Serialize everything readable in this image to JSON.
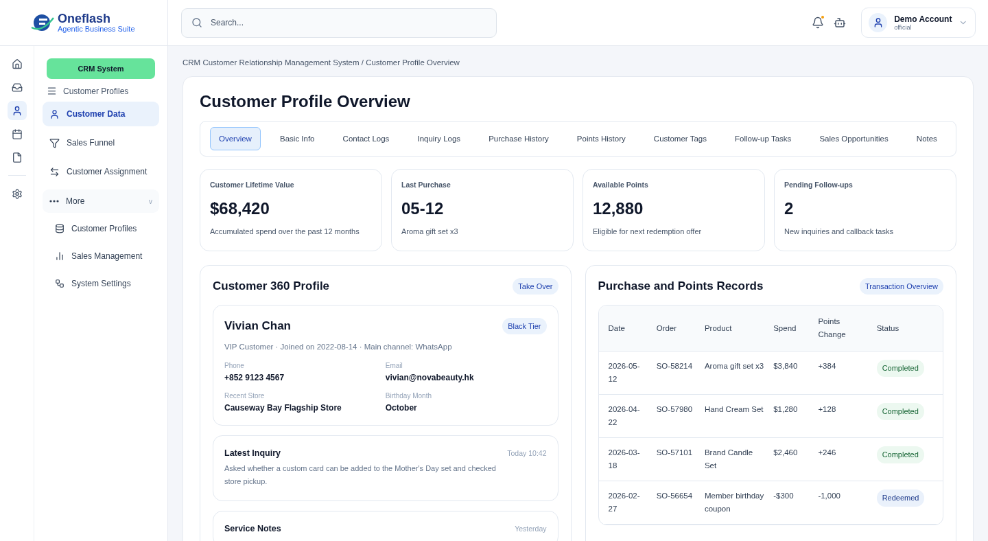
{
  "brand": {
    "name": "Oneflash",
    "tagline": "Agentic Business Suite"
  },
  "search": {
    "placeholder": "Search..."
  },
  "account": {
    "name": "Demo Account",
    "role": "official",
    "notification": true
  },
  "rail": [
    {
      "selected": false
    },
    {
      "selected": false
    },
    {
      "selected": true
    },
    {
      "selected": false
    },
    {
      "selected": false
    },
    {
      "selected": false
    }
  ],
  "nav": {
    "system": "CRM System",
    "section": "Customer Profiles",
    "items": [
      {
        "label": "Customer Data",
        "selected": true
      },
      {
        "label": "Sales Funnel",
        "selected": false
      },
      {
        "label": "Customer Assignment",
        "selected": false
      }
    ],
    "more": {
      "label": "More",
      "caret": "v",
      "children": [
        {
          "label": "Customer Profiles",
          "selected": false
        },
        {
          "label": "Sales Management",
          "selected": false
        },
        {
          "label": "System Settings",
          "selected": false
        }
      ]
    }
  },
  "breadcrumb": "CRM Customer Relationship Management System / Customer Profile Overview",
  "page_title": "Customer Profile Overview",
  "tabs": [
    {
      "label": "Overview",
      "selected": true
    },
    {
      "label": "Basic Info",
      "selected": false
    },
    {
      "label": "Contact Logs",
      "selected": false
    },
    {
      "label": "Inquiry Logs",
      "selected": false
    },
    {
      "label": "Purchase History",
      "selected": false
    },
    {
      "label": "Points History",
      "selected": false
    },
    {
      "label": "Customer Tags",
      "selected": false
    },
    {
      "label": "Follow-up Tasks",
      "selected": false
    },
    {
      "label": "Sales Opportunities",
      "selected": false
    },
    {
      "label": "Notes",
      "selected": false
    }
  ],
  "stats": [
    {
      "label": "Customer Lifetime Value",
      "value": "$68,420",
      "note": "Accumulated spend over the past 12 months"
    },
    {
      "label": "Last Purchase",
      "value": "05-12",
      "note": "Aroma gift set x3"
    },
    {
      "label": "Available Points",
      "value": "12,880",
      "note": "Eligible for next redemption offer"
    },
    {
      "label": "Pending Follow-ups",
      "value": "2",
      "note": "New inquiries and callback tasks"
    }
  ],
  "profile_panel": {
    "title": "Customer 360 Profile",
    "action": "Take Over",
    "customer": {
      "name": "Vivian Chan",
      "tier": "Black Tier",
      "summary": "VIP Customer · Joined on 2022-08-14 · Main channel: WhatsApp",
      "fields": [
        {
          "label": "Phone",
          "value": "+852 9123 4567"
        },
        {
          "label": "Email",
          "value": "vivian@novabeauty.hk"
        },
        {
          "label": "Recent Store",
          "value": "Causeway Bay Flagship Store"
        },
        {
          "label": "Birthday Month",
          "value": "October"
        }
      ]
    },
    "notes": [
      {
        "title": "Latest Inquiry",
        "time": "Today 10:42",
        "text": "Asked whether a custom card can be added to the Mother's Day set and checked store pickup."
      },
      {
        "title": "Service Notes",
        "time": "Yesterday"
      }
    ]
  },
  "records_panel": {
    "title": "Purchase and Points Records",
    "action": "Transaction Overview",
    "table": {
      "columns": [
        "Date",
        "Order",
        "Product",
        "Spend",
        "Points Change",
        "Status"
      ],
      "rows": [
        {
          "cells": [
            "2026-05-12",
            "SO-58214",
            "Aroma gift set x3",
            "$3,840",
            "+384"
          ],
          "status": "Completed",
          "kind": "completed"
        },
        {
          "cells": [
            "2026-04-22",
            "SO-57980",
            "Hand Cream Set",
            "$1,280",
            "+128"
          ],
          "status": "Completed",
          "kind": "completed"
        },
        {
          "cells": [
            "2026-03-18",
            "SO-57101",
            "Brand Candle Set",
            "$2,460",
            "+246"
          ],
          "status": "Completed",
          "kind": "completed"
        },
        {
          "cells": [
            "2026-02-27",
            "SO-56654",
            "Member birthday coupon",
            "-$300",
            "-1,000"
          ],
          "status": "Redeemed",
          "kind": "redeemed"
        }
      ]
    }
  }
}
